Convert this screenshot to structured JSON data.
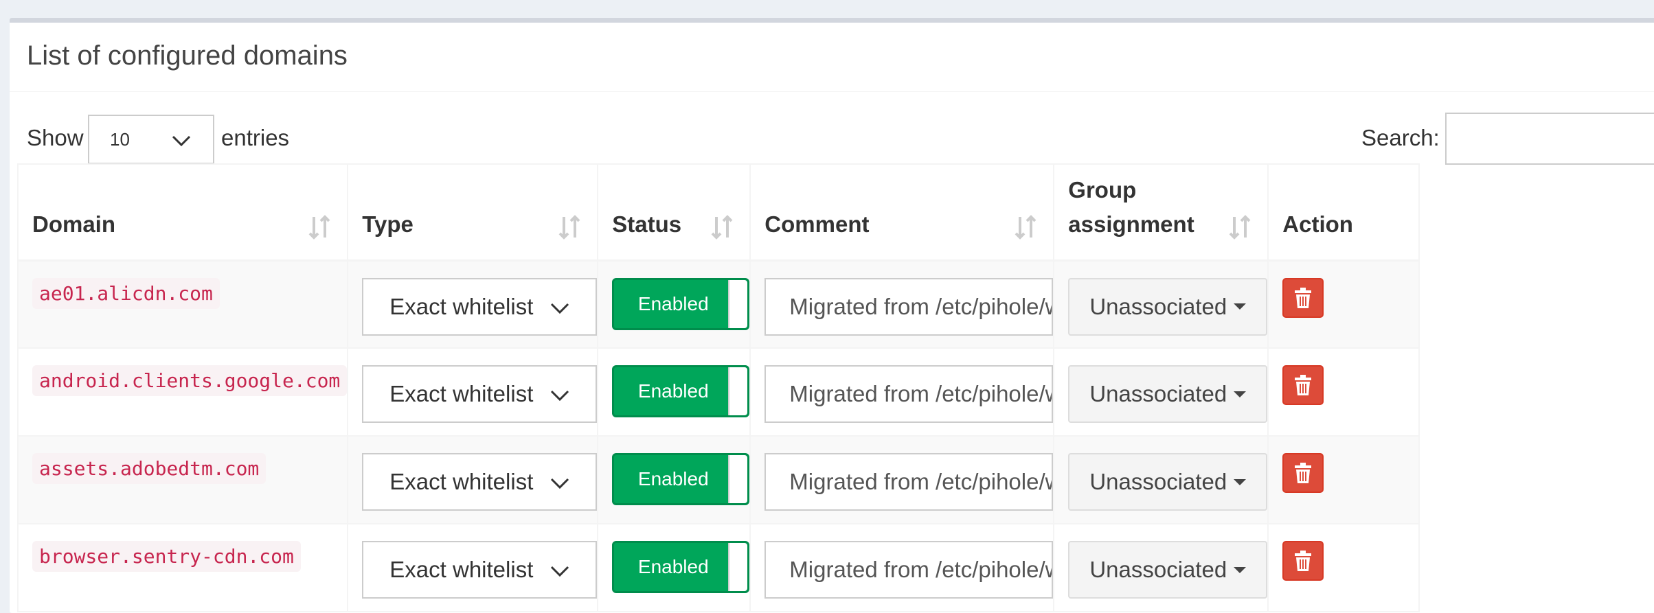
{
  "title": "List of configured domains",
  "length_control": {
    "show_label": "Show",
    "value": "10",
    "entries_label": "entries"
  },
  "search": {
    "label": "Search:",
    "value": ""
  },
  "columns": [
    {
      "label": "Domain"
    },
    {
      "label": "Type"
    },
    {
      "label": "Status"
    },
    {
      "label": "Comment"
    },
    {
      "label": "Group assignment"
    },
    {
      "label": "Action"
    }
  ],
  "rows": [
    {
      "domain": "ae01.alicdn.com",
      "type": "Exact whitelist",
      "status": "Enabled",
      "comment": "Migrated from /etc/pihole/whitelist.txt",
      "group": "Unassociated"
    },
    {
      "domain": "android.clients.google.com",
      "type": "Exact whitelist",
      "status": "Enabled",
      "comment": "Migrated from /etc/pihole/whitelist.txt",
      "group": "Unassociated"
    },
    {
      "domain": "assets.adobedtm.com",
      "type": "Exact whitelist",
      "status": "Enabled",
      "comment": "Migrated from /etc/pihole/whitelist.txt",
      "group": "Unassociated"
    },
    {
      "domain": "browser.sentry-cdn.com",
      "type": "Exact whitelist",
      "status": "Enabled",
      "comment": "Migrated from /etc/pihole/whitelist.txt",
      "group": "Unassociated"
    }
  ],
  "colors": {
    "toggle_on": "#00a65a",
    "delete": "#dd4b39",
    "code_text": "#c7254e",
    "code_bg": "#f9f2f4"
  },
  "icons": {
    "sort": "sort-both-icon",
    "delete": "trash-icon",
    "dropdown": "chevron-down-icon"
  }
}
